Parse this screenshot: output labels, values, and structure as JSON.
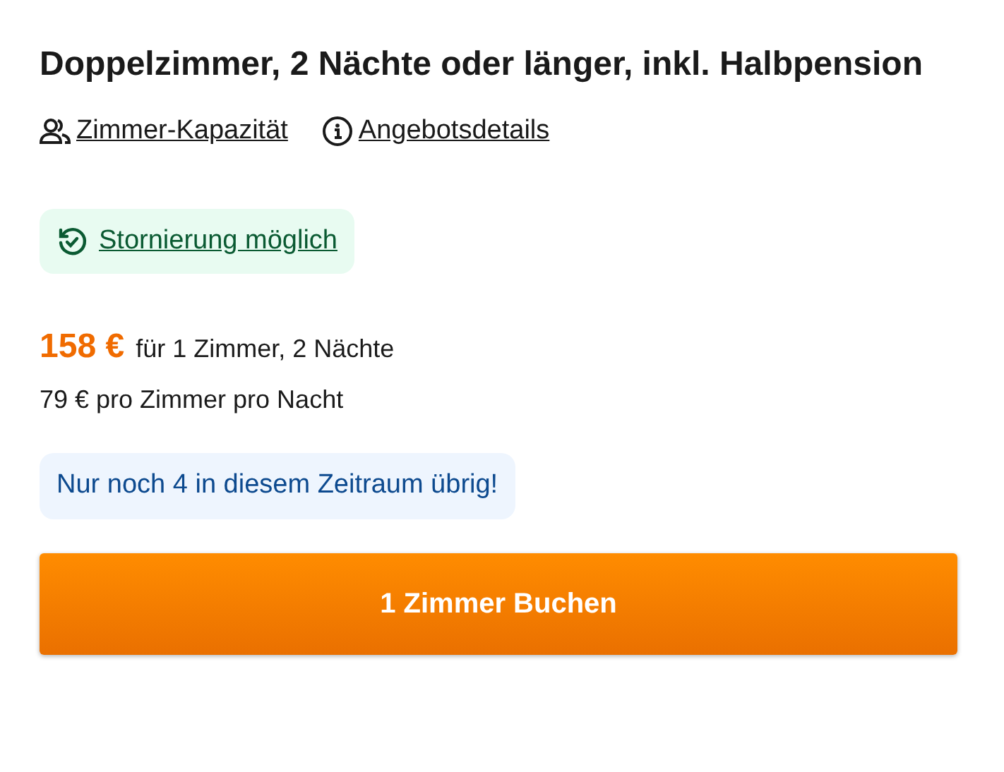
{
  "title": "Doppelzimmer, 2 Nächte oder länger, inkl. Halbpension",
  "links": [
    {
      "kind": "capacity",
      "label": "Zimmer-Kapazität"
    },
    {
      "kind": "info",
      "label": "Angebotsdetails"
    }
  ],
  "cancellation": {
    "label": "Stornierung möglich"
  },
  "price": {
    "total": "158 €",
    "total_note": "für 1 Zimmer, 2 Nächte",
    "per_night": "79 € pro Zimmer pro Nacht"
  },
  "availability": "Nur noch 4 in diesem Zeitraum übrig!",
  "book_button": "1 Zimmer Buchen"
}
